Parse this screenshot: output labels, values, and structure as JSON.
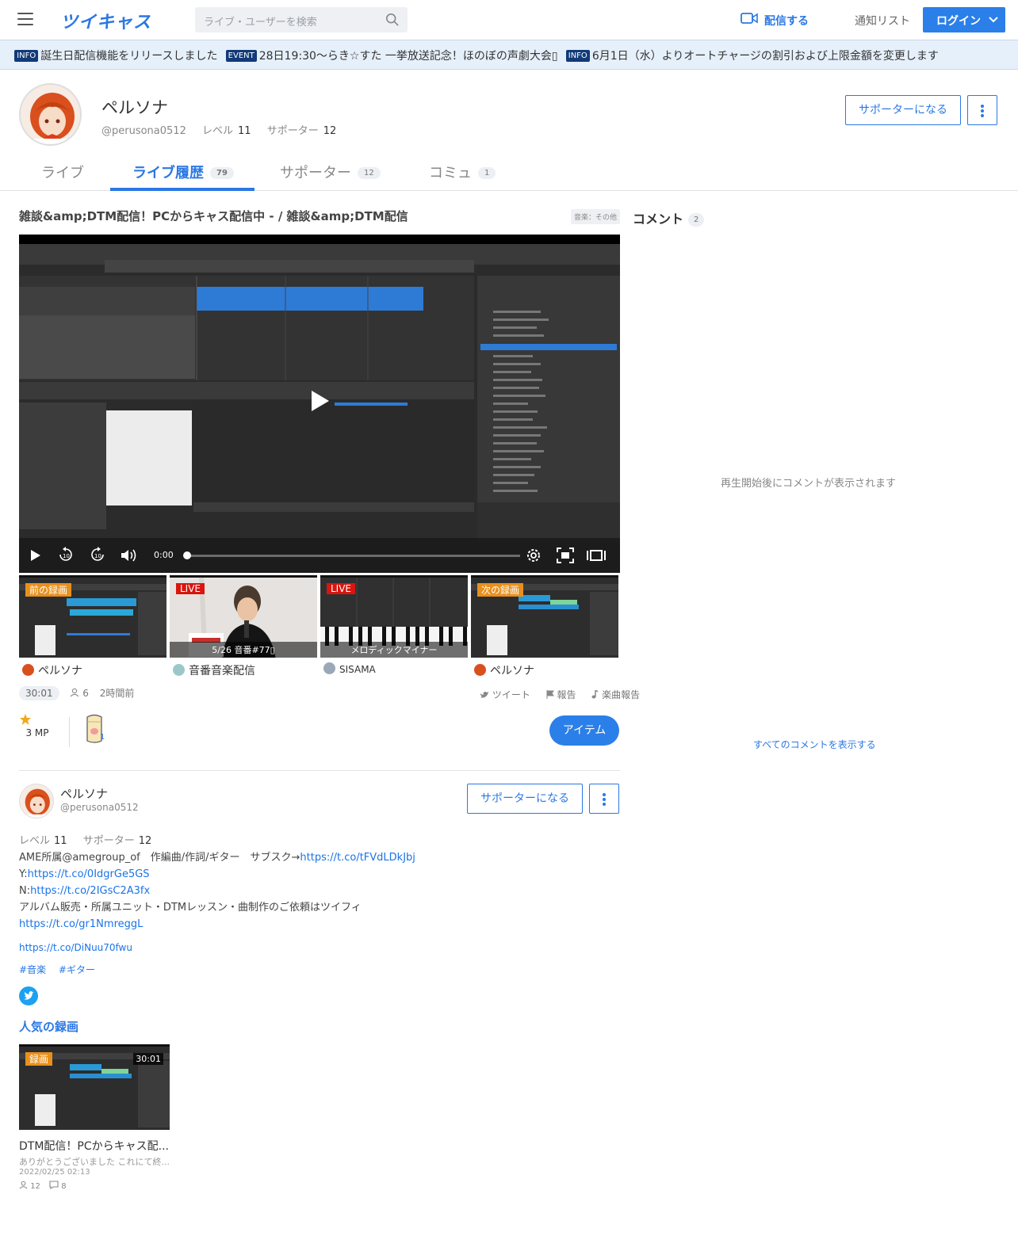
{
  "header": {
    "logo": "ツイキャス",
    "search_placeholder": "ライブ・ユーザーを検索",
    "broadcast_label": "配信する",
    "notify_label": "通知リスト",
    "login_label": "ログイン"
  },
  "infobar": [
    {
      "badge": "INFO",
      "text": "誕生日配信機能をリリースしました"
    },
    {
      "badge": "EVENT",
      "text": "28日19:30〜らき☆すた 一挙放送記念！ほのぼの声劇大会▯"
    },
    {
      "badge": "INFO",
      "text": "6月1日（水）よりオートチャージの割引および上限金額を変更します"
    }
  ],
  "profile": {
    "name": "ペルソナ",
    "id": "@perusona0512",
    "level_label": "レベル",
    "level": "11",
    "supporter_label": "サポーター",
    "supporters": "12",
    "support_button": "サポーターになる"
  },
  "tabs": [
    {
      "label": "ライブ",
      "count": ""
    },
    {
      "label": "ライブ履歴",
      "count": "79"
    },
    {
      "label": "サポーター",
      "count": "12"
    },
    {
      "label": "コミュ",
      "count": "1"
    }
  ],
  "stream": {
    "title": "雑談&amp;DTM配信！PCからキャス配信中 - / 雑談&amp;DTM配信",
    "genre": "音楽：その他",
    "time": "0:00",
    "duration": "30:01",
    "viewers": "6",
    "ago": "2時間前",
    "tweet": "ツイート",
    "report": "報告",
    "song_report": "楽曲報告",
    "mp": "3 MP",
    "item_badge": "1",
    "item_button": "アイテム"
  },
  "related": [
    {
      "tag": "前の録画",
      "caption": "",
      "owner": "ペルソナ"
    },
    {
      "tag": "LIVE",
      "caption": "5/26 音番#77▯",
      "owner": "音番音楽配信"
    },
    {
      "tag": "LIVE",
      "caption": "メロディックマイナー",
      "owner": "SISAMA"
    },
    {
      "tag": "次の録画",
      "caption": "",
      "owner": "ペルソナ"
    }
  ],
  "card": {
    "name": "ペルソナ",
    "id": "@perusona0512",
    "support_button": "サポーターになる",
    "level_label": "レベル",
    "level": "11",
    "supporter_label": "サポーター",
    "supporters": "12",
    "bio_line1": "AME所属@amegroup_of　作編曲/作詞/ギター　サブスク→",
    "bio_link1": "https://t.co/tFVdLDkJbj",
    "bio_line2_prefix": "Y:",
    "bio_link2": "https://t.co/0IdgrGe5GS",
    "bio_line3_prefix": "N:",
    "bio_link3": "https://t.co/2IGsC2A3fx",
    "bio_line4": "アルバム販売・所属ユニット・DTMレッスン・曲制作のご依頼はツイフィ",
    "bio_link4": "https://t.co/gr1NmreggL",
    "bio_link5": "https://t.co/DiNuu70fwu",
    "hashtags": [
      "#音楽",
      "#ギター"
    ]
  },
  "popular": {
    "title": "人気の録画",
    "tag": "録画",
    "duration": "30:01",
    "video_title": "DTM配信！PCからキャス配...",
    "comment": "ありがとうございました これにて終...",
    "date": "2022/02/25 02:13",
    "viewers": "12",
    "comments": "8"
  },
  "comments": {
    "title": "コメント",
    "count": "2",
    "empty": "再生開始後にコメントが表示されます",
    "show_all": "すべてのコメントを表示する"
  },
  "colors": {
    "accent": "#2b78e4",
    "info_badge": "#123a78",
    "live_red": "#d9150f",
    "recording_orange": "#e8901c"
  }
}
